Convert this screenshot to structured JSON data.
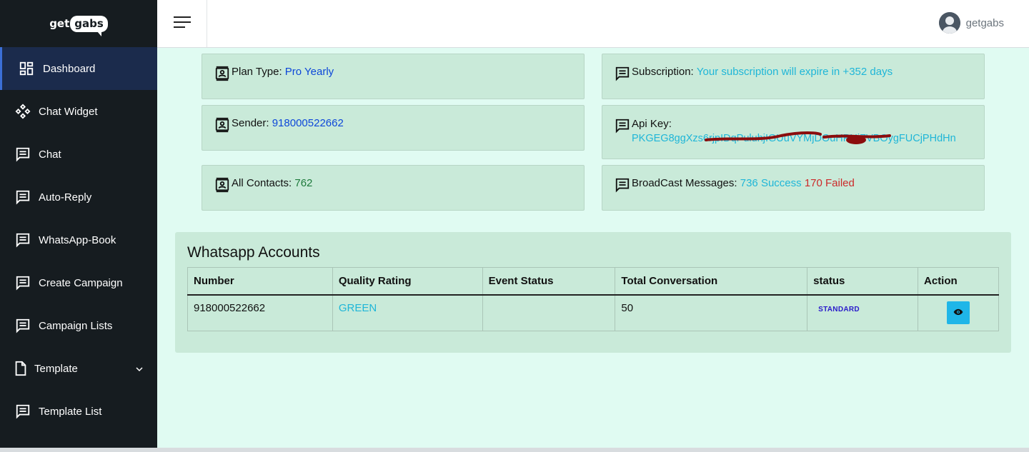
{
  "app": {
    "logo_left": "get",
    "logo_bubble": "gabs",
    "user_name": "getgabs"
  },
  "sidebar": {
    "items": [
      {
        "label": "Dashboard",
        "icon": "dashboard-icon",
        "active": true
      },
      {
        "label": "Chat Widget",
        "icon": "widget-icon"
      },
      {
        "label": "Chat",
        "icon": "message-icon"
      },
      {
        "label": "Auto-Reply",
        "icon": "message-icon"
      },
      {
        "label": "WhatsApp-Book",
        "icon": "message-icon"
      },
      {
        "label": "Create Campaign",
        "icon": "message-icon"
      },
      {
        "label": "Campaign Lists",
        "icon": "message-icon"
      },
      {
        "label": "Template",
        "icon": "file-icon",
        "has_chevron": true
      },
      {
        "label": "Template List",
        "icon": "message-icon"
      }
    ]
  },
  "cards": {
    "plan": {
      "label": "Plan Type:",
      "value": "Pro Yearly"
    },
    "sender": {
      "label": "Sender:",
      "value": "918000522662"
    },
    "contacts": {
      "label": "All Contacts:",
      "value": "762"
    },
    "subscription": {
      "label": "Subscription:",
      "value": "Your subscription will expire in +352 days"
    },
    "api_key": {
      "label": "Api Key:",
      "value": "PKGEG8ggXzs6rjpIDqPuluhjIGUuVYMjDOuHPUiZVBOygFUCjPHdHn"
    },
    "broadcast": {
      "label": "BroadCast Messages:",
      "success": "736 Success",
      "failed": "170 Failed"
    }
  },
  "accounts": {
    "title": "Whatsapp Accounts",
    "headers": [
      "Number",
      "Quality Rating",
      "Event Status",
      "Total Conversation",
      "status",
      "Action"
    ],
    "rows": [
      {
        "number": "918000522662",
        "quality": "GREEN",
        "event_status": "",
        "total": "50",
        "status": "STANDARD"
      }
    ]
  },
  "colors": {
    "sidebar_bg": "#161c20",
    "active_bg": "#1b2b4c",
    "main_bg": "#e0fbf2",
    "card_bg": "#c9ead9",
    "accent_cyan": "#1fb6d8",
    "accent_blue": "#0d47d9"
  }
}
